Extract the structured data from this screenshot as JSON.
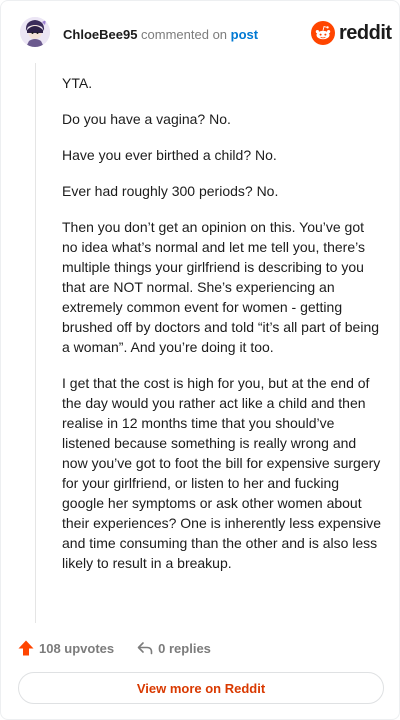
{
  "header": {
    "username": "ChloeBee95",
    "action_text": "commented on",
    "post_link": "post",
    "brand_name": "reddit"
  },
  "comment": {
    "paragraphs": [
      "YTA.",
      "Do you have a vagina? No.",
      "Have you ever birthed a child? No.",
      "Ever had roughly 300 periods? No.",
      "Then you don’t get an opinion on this. You’ve got no idea what’s normal and let me tell you, there’s multiple things your girlfriend is describing to you that are NOT normal. She’s experiencing an extremely common event for women - getting brushed off by doctors and told “it’s all part of being a woman”. And you’re doing it too.",
      "I get that the cost is high for you, but at the end of the day would you rather act like a child and then realise in 12 months time that you should’ve listened because something is really wrong and now you’ve got to foot the bill for expensive surgery for your girlfriend, or listen to her and fucking google her symptoms or ask other women about their experiences? One is inherently less expensive and time consuming than the other and is also less likely to result in a breakup."
    ]
  },
  "footer": {
    "upvotes": "108 upvotes",
    "replies": "0 replies",
    "view_more": "View more on Reddit"
  },
  "colors": {
    "brand_orange": "#ff4500",
    "link_blue": "#0079d3",
    "view_more_text": "#d93900",
    "muted_text": "#7c7c7c"
  },
  "icons": {
    "avatar": "avatar-icon",
    "brand": "reddit-logo-icon",
    "upvote": "upvote-arrow-icon",
    "reply": "reply-arrow-icon"
  }
}
